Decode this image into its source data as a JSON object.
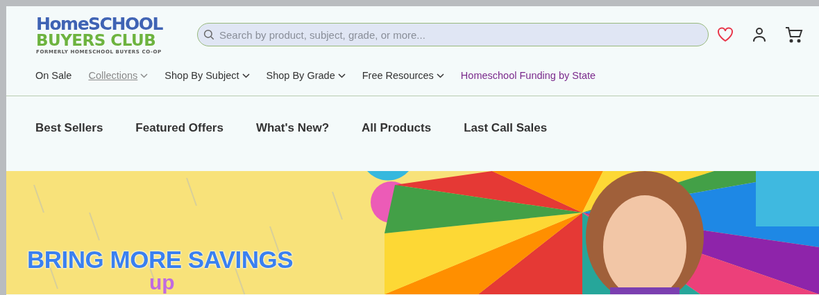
{
  "logo": {
    "line1": "HomeSCHOOL",
    "line2": "BUYERS CLUB",
    "tagline": "FORMERLY HOMESCHOOL BUYERS CO-OP"
  },
  "search": {
    "placeholder": "Search by product, subject, grade, or more..."
  },
  "main_nav": [
    {
      "label": "On Sale",
      "kind": "plain",
      "selected": false
    },
    {
      "label": "Collections",
      "kind": "dropdown",
      "selected": true
    },
    {
      "label": "Shop By Subject",
      "kind": "dropdown",
      "selected": false
    },
    {
      "label": "Shop By Grade",
      "kind": "dropdown",
      "selected": false
    },
    {
      "label": "Free Resources",
      "kind": "dropdown",
      "selected": false
    },
    {
      "label": "Homeschool Funding by State",
      "kind": "featured",
      "selected": false
    }
  ],
  "sub_nav": [
    "Best Sellers",
    "Featured Offers",
    "What's New?",
    "All Products",
    "Last Call Sales"
  ],
  "banner": {
    "kind": "picture",
    "headline": "BRING MORE SAVINGS",
    "subline": "up"
  }
}
